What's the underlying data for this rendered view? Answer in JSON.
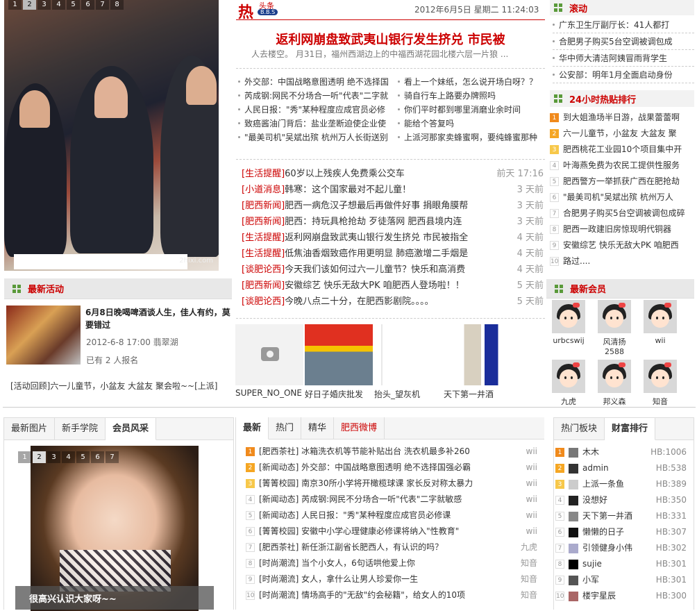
{
  "slider": {
    "pages": [
      "1",
      "2",
      "3",
      "4",
      "5",
      "6",
      "7",
      "8"
    ],
    "active": 1,
    "watermark": "2hixi.com"
  },
  "activity": {
    "title": "最新活动",
    "event_title": "6月8日晚喝啤酒谈人生，佳人有约，莫要错过",
    "event_time": "2012-6-8 17:00 翡翠湖",
    "signup": "已有 2 人报名",
    "review": "[活动回顾]六一儿童节，小盆友 大盆友 聚会啦~~[上派]"
  },
  "header": {
    "logo_top": "头条",
    "logo_bottom": "B.B.S",
    "date": "2012年6月5日 星期二 11:24:03"
  },
  "headline": {
    "title": "返利网崩盘致武夷山银行发生挤兑 市民被",
    "summary": "人去楼空。        月31日，福州西湖边上的中福西湖花园北楼六层一片狼 ..."
  },
  "hot_left": [
    "外交部：中国战略意图透明 绝不选择国",
    "芮成钢:网民不分场合一听\"代表\"二字就",
    "人民日报：\"秀\"某种程度应成官员必修",
    "致癌酱油门背后：盐业垄断迫使企业使",
    "\"最美司机\"吴斌出殡 杭州万人长街送别"
  ],
  "hot_right": [
    "看上一个妹纸，怎么说开场白呀？？",
    "骑自行车上路要办牌照吗",
    "你们平时都到哪里消磨业余时间",
    "能给个答复吗",
    "上派河那家卖蜂蜜啊，要纯蜂蜜那种"
  ],
  "news": [
    {
      "cat": "[生活提醒]",
      "title": "60岁以上残疾人免费乘公交车",
      "time": "前天 17:16"
    },
    {
      "cat": "[小道消息]",
      "title": "韩寒：这个国家最对不起儿童！",
      "time": "3 天前"
    },
    {
      "cat": "[肥西新闻]",
      "title": "肥西一病危汉子想最后再做件好事 捐眼角膜帮",
      "time": "3 天前"
    },
    {
      "cat": "[肥西新闻]",
      "title": "肥西：持玩具枪抢劫 歹徒落网 肥西县境内连",
      "time": "3 天前"
    },
    {
      "cat": "[生活提醒]",
      "title": "返利网崩盘致武夷山银行发生挤兑 市民被指全",
      "time": "4 天前"
    },
    {
      "cat": "[生活提醒]",
      "title": "低焦油香烟致癌作用更明显 肺癌激增二手烟是",
      "time": "4 天前"
    },
    {
      "cat": "[谈肥论西]",
      "title": "今天我们该如何过六一儿童节？快乐和高消费",
      "time": "4 天前"
    },
    {
      "cat": "[肥西新闻]",
      "title": "安徽综艺 快乐无敌大PK 咱肥西人登场啦！！",
      "time": "5 天前"
    },
    {
      "cat": "[谈肥论西]",
      "title": "今晚八点二十分，在肥西影剧院。。。。",
      "time": "5 天前"
    }
  ],
  "thumbs": [
    "SUPER_NO_ONE",
    "好日子婚庆批发",
    "抬头_望灰机",
    "天下第一井酒"
  ],
  "scroll": {
    "title": "滚动",
    "items": [
      "广东卫生厅副厅长：41人都打",
      "合肥男子购买5台空调被调包成",
      "华中师大清洁阿姨冒雨背学生",
      "公安部：明年1月全面启动身份"
    ]
  },
  "hot24": {
    "title": "24小时热贴排行",
    "items": [
      "到大姐渔场半日游，战果蕾蕾啊",
      "六一儿童节，小盆友 大盆友 聚",
      "肥西桃花工业园10个项目集中开",
      "叶海燕免费为农民工提供性服务",
      "肥西警方一举抓获广西在肥抢劫",
      "\"最美司机\"吴斌出殡 杭州万人",
      "合肥男子购买5台空调被调包成碎",
      "肥西一政建旧房惊现明代铜器",
      "安徽综艺 快乐无敌大PK 咱肥西",
      "路过...."
    ]
  },
  "members": {
    "title": "最新会员",
    "names": [
      "urbcswij",
      "风清扬2588",
      "wii",
      "九虎",
      "邦义森",
      "知音"
    ]
  },
  "bottom_left": {
    "tabs": [
      "最新图片",
      "新手学院",
      "会员风采"
    ],
    "active": 2,
    "pages": [
      "1",
      "2",
      "3",
      "4",
      "5",
      "6",
      "7"
    ],
    "caption": "很高兴认识大家呀~~"
  },
  "bottom_mid": {
    "tabs": [
      "最新",
      "热门",
      "精华",
      "肥西微博"
    ],
    "active": 0,
    "threads": [
      {
        "t": "[肥西茶社] 冰箱洗衣机等节能补贴出台 洗衣机最多补260",
        "u": "wii"
      },
      {
        "t": "[新闻动态] 外交部：中国战略意图透明 绝不选择国强必霸",
        "u": "wii"
      },
      {
        "t": "[箐箐校园] 南京30所小学将开橄榄球课 家长反对称太暴力",
        "u": "wii"
      },
      {
        "t": "[新闻动态] 芮成钢:网民不分场合一听\"代表\"二字就敏感",
        "u": "wii"
      },
      {
        "t": "[新闻动态] 人民日报：\"秀\"某种程度应成官员必修课",
        "u": "wii"
      },
      {
        "t": "[箐箐校园] 安徽中小学心理健康必修课将纳入\"性教育\"",
        "u": "wii"
      },
      {
        "t": "[肥西茶社] 新任浙江副省长肥西人，有认识的吗？",
        "u": "九虎"
      },
      {
        "t": "[时尚潮流] 当个小女人，6句话哄他爱上你",
        "u": "知音"
      },
      {
        "t": "[时尚潮流] 女人，拿什么让男人珍爱你一生",
        "u": "知音"
      },
      {
        "t": "[时尚潮流] 情场高手的\"无敌\"约会秘籍\"，给女人的10项",
        "u": "知音"
      }
    ]
  },
  "bottom_right": {
    "tabs": [
      "热门板块",
      "财富排行"
    ],
    "active": 1,
    "rows": [
      {
        "n": "木木",
        "hb": "HB:1006"
      },
      {
        "n": "admin",
        "hb": "HB:538"
      },
      {
        "n": "上派一条鱼",
        "hb": "HB:389"
      },
      {
        "n": "没想好",
        "hb": "HB:350"
      },
      {
        "n": "天下第一井酒",
        "hb": "HB:331"
      },
      {
        "n": "懒懒的日子",
        "hb": "HB:307"
      },
      {
        "n": "引领健身小伟",
        "hb": "HB:302"
      },
      {
        "n": "sujie",
        "hb": "HB:301"
      },
      {
        "n": "小军",
        "hb": "HB:301"
      },
      {
        "n": "楼宇星辰",
        "hb": "HB:300"
      }
    ]
  }
}
